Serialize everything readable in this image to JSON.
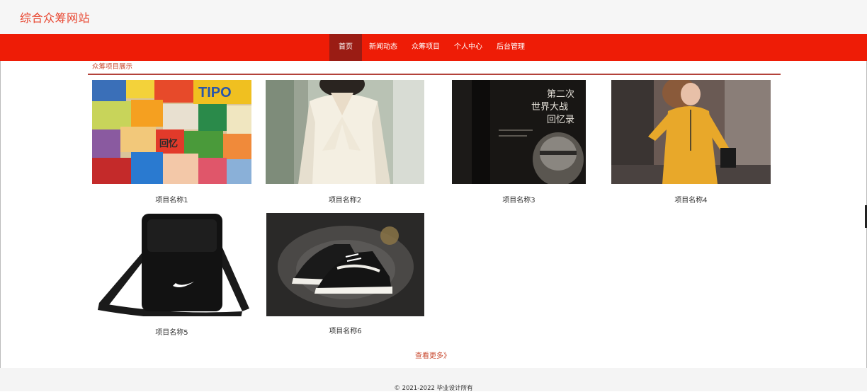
{
  "header": {
    "site_title": "综合众筹网站"
  },
  "nav": {
    "items": [
      {
        "label": "首页",
        "active": true
      },
      {
        "label": "新闻动态",
        "active": false
      },
      {
        "label": "众筹项目",
        "active": false
      },
      {
        "label": "个人中心",
        "active": false
      },
      {
        "label": "后台管理",
        "active": false
      }
    ]
  },
  "section": {
    "title": "众筹项目展示",
    "projects": [
      {
        "name": "项目名称1",
        "image": "snacks-photo"
      },
      {
        "name": "项目名称2",
        "image": "white-blouse-photo"
      },
      {
        "name": "项目名称3",
        "image": "book-cover-photo"
      },
      {
        "name": "项目名称4",
        "image": "yellow-sweater-photo"
      },
      {
        "name": "项目名称5",
        "image": "black-shoulder-bag-photo"
      },
      {
        "name": "项目名称6",
        "image": "black-sneakers-photo"
      }
    ],
    "more_label": "查看更多》",
    "book_text": {
      "line1": "第二次",
      "line2": "世界大战",
      "line3": "回忆录"
    },
    "snack_text": {
      "brand": "TIPO",
      "side": "回忆"
    }
  },
  "footer": {
    "copyright": "© 2021-2022 毕业设计所有"
  },
  "colors": {
    "brand": "#e8442e",
    "navbar": "#ee1c06",
    "nav_active": "#9a1c14"
  }
}
